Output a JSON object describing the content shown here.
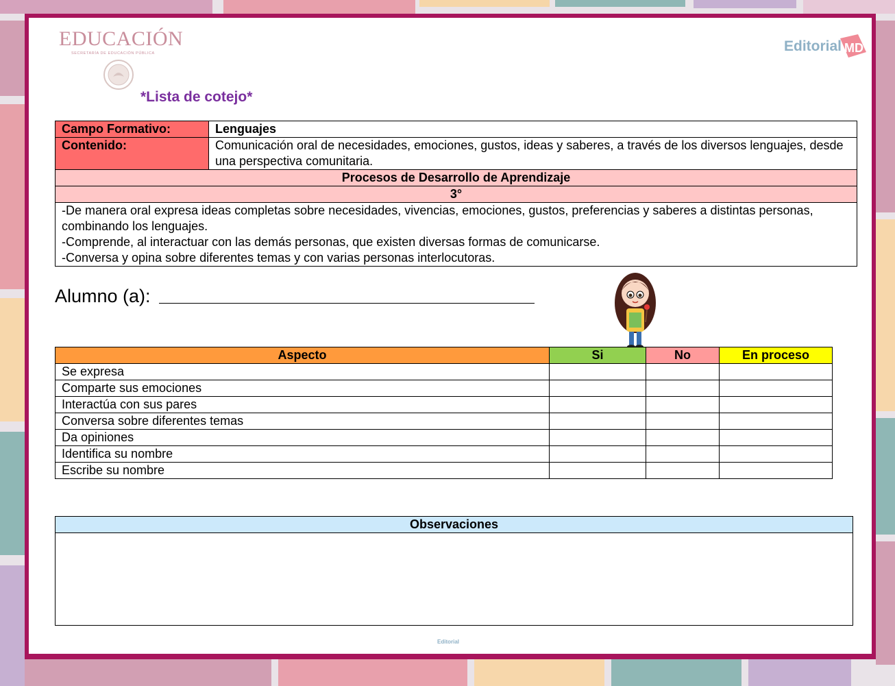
{
  "header": {
    "institution": "EDUCACIÓN",
    "institution_sub": "SECRETARÍA DE EDUCACIÓN PÚBLICA",
    "publisher": "Editorial",
    "publisher_mark": "MD",
    "footer_publisher": "Editorial"
  },
  "title": "*Lista de cotejo*",
  "info": {
    "campo_label": "Campo Formativo:",
    "campo_value": "Lenguajes",
    "contenido_label": "Contenido:",
    "contenido_value": "Comunicación oral de necesidades, emociones, gustos, ideas y saberes, a través de los diversos lenguajes, desde una perspectiva comunitaria.",
    "procesos_header": "Procesos de Desarrollo de Aprendizaje",
    "grade": "3°",
    "processes": [
      "-De manera oral expresa ideas completas sobre necesidades, vivencias, emociones, gustos, preferencias y saberes a distintas personas, combinando los lenguajes.",
      "-Comprende, al interactuar con las demás personas, que existen diversas formas de comunicarse.",
      "-Conversa y opina sobre diferentes temas y con varias personas interlocutoras."
    ]
  },
  "alumno_label": "Alumno (a):",
  "checklist": {
    "headers": {
      "aspecto": "Aspecto",
      "si": "Si",
      "no": "No",
      "en_proceso": "En proceso"
    },
    "rows": [
      "Se expresa",
      "Comparte sus emociones",
      "Interactúa con sus pares",
      "Conversa sobre diferentes temas",
      "Da opiniones",
      "Identifica su nombre",
      "Escribe su nombre"
    ]
  },
  "observaciones_label": "Observaciones",
  "colors": {
    "frame": "#a8155c",
    "label_red": "#ff6b6b",
    "header_pink": "#ffc7c7",
    "aspecto_orange": "#ff9a3c",
    "si_green": "#92d050",
    "no_pink": "#ff9a9a",
    "proceso_yellow": "#ffff00",
    "obs_blue": "#cce9fb",
    "title_purple": "#7a2f9e"
  }
}
